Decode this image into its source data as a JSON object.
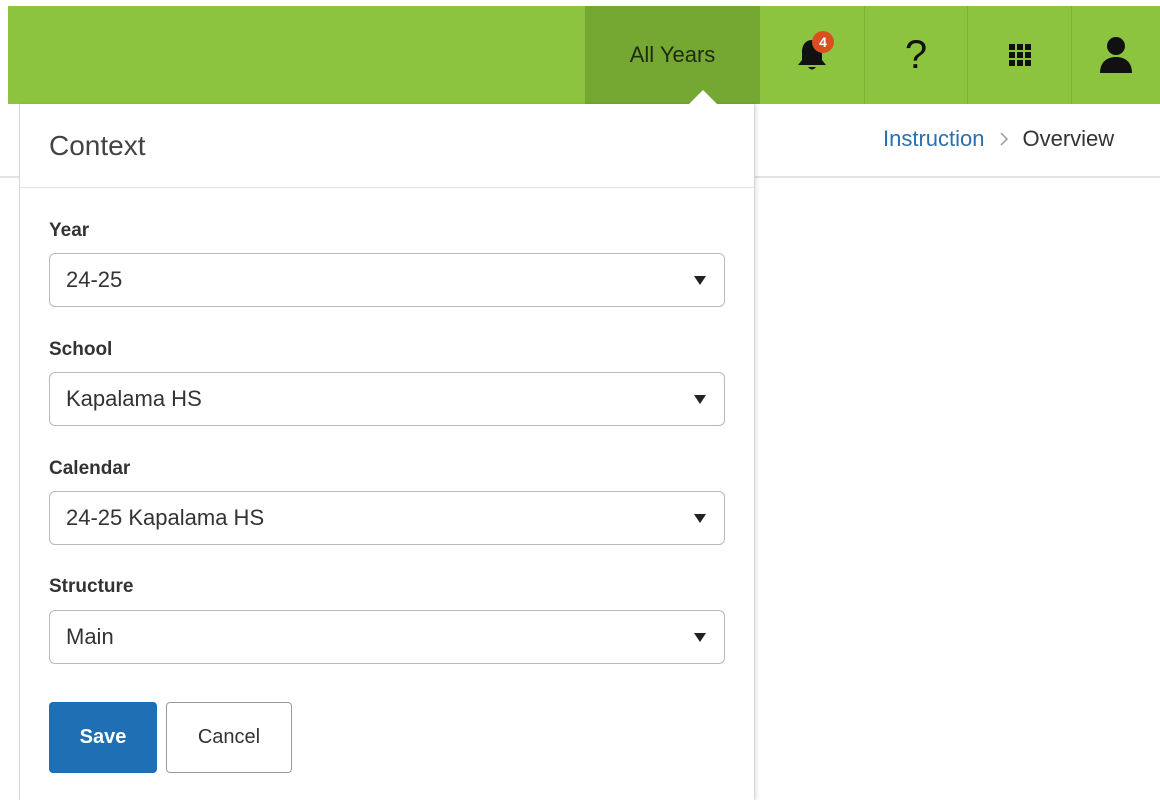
{
  "topbar": {
    "year_selector_label": "All Years",
    "notifications_count": "4",
    "help_glyph": "?",
    "icons": [
      "bell-icon",
      "help-icon",
      "app-grid-icon",
      "user-icon"
    ],
    "color": "#8dc43f",
    "active_color": "#74a832"
  },
  "breadcrumb": {
    "parent": "Instruction",
    "current": "Overview",
    "link_color": "#2a6fb0"
  },
  "context_panel": {
    "title": "Context",
    "fields": [
      {
        "label": "Year",
        "value": "24-25"
      },
      {
        "label": "School",
        "value": "Kapalama HS"
      },
      {
        "label": "Calendar",
        "value": "24-25 Kapalama HS"
      },
      {
        "label": "Structure",
        "value": "Main"
      }
    ],
    "save_label": "Save",
    "cancel_label": "Cancel",
    "save_color": "#1f6fb5"
  }
}
